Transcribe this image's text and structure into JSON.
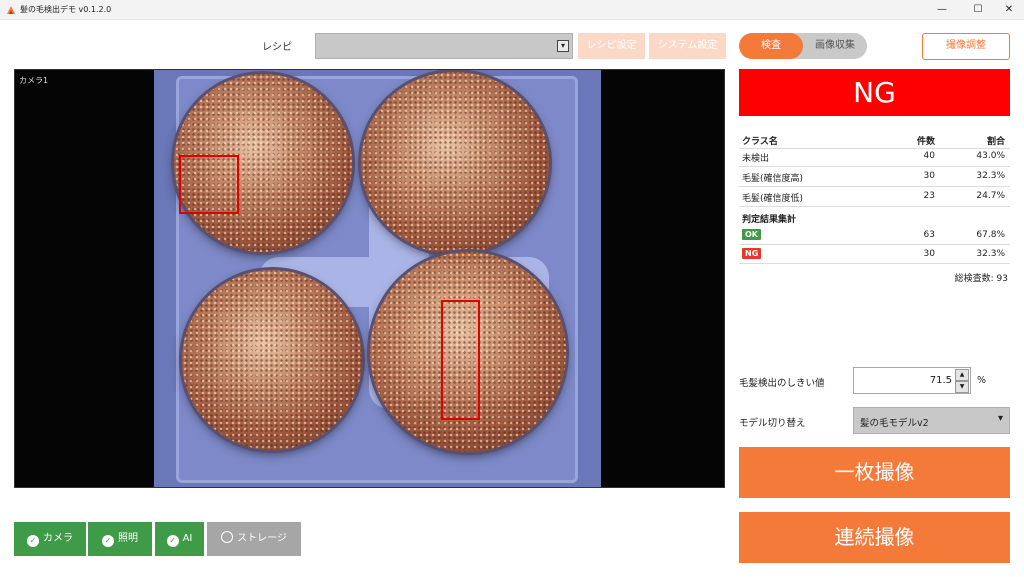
{
  "window": {
    "title": "髪の毛検出デモ v0.1.2.0",
    "minimize_glyph": "—",
    "maximize_glyph": "☐",
    "close_glyph": "✕"
  },
  "toolbar": {
    "recipe_label": "レシピ",
    "recipe_value": "",
    "recipe_settings_label": "レシピ設定",
    "system_settings_label": "システム設定"
  },
  "mode_toggle": {
    "options": [
      "検査",
      "画像収集"
    ],
    "active": "検査"
  },
  "capture_adjust_label": "撮像調整",
  "camera": {
    "label": "カメラ1"
  },
  "result": {
    "verdict": "NG",
    "verdict_color": "#ff0000"
  },
  "stats": {
    "headers": [
      "クラス名",
      "件数",
      "割合"
    ],
    "rows": [
      {
        "name": "未検出",
        "count": "40",
        "ratio": "43.0%"
      },
      {
        "name": "毛髪(確信度高)",
        "count": "30",
        "ratio": "32.3%"
      },
      {
        "name": "毛髪(確信度低)",
        "count": "23",
        "ratio": "24.7%"
      }
    ],
    "summary_title": "判定結果集計",
    "summary": [
      {
        "tag": "OK",
        "tag_color": "#3f9b47",
        "count": "63",
        "ratio": "67.8%"
      },
      {
        "tag": "NG",
        "tag_color": "#e53a2b",
        "count": "30",
        "ratio": "32.3%"
      }
    ],
    "total": "総検査数: 93"
  },
  "threshold": {
    "label": "毛髪検出のしきい値",
    "value": "71.5",
    "unit": "%"
  },
  "model": {
    "label": "モデル切り替え",
    "value": "髪の毛モデルv2"
  },
  "actions": {
    "single_capture": "一枚撮像",
    "continuous_capture": "連続撮像"
  },
  "status": [
    {
      "label": "カメラ",
      "state": "ok",
      "color": "#3f9b47",
      "icon": "check-circle-icon"
    },
    {
      "label": "照明",
      "state": "ok",
      "color": "#3f9b47",
      "icon": "check-circle-icon"
    },
    {
      "label": "AI",
      "state": "ok",
      "color": "#3f9b47",
      "icon": "check-circle-icon"
    },
    {
      "label": "ストレージ",
      "state": "off",
      "color": "#a6a6a6",
      "icon": "empty-circle-icon"
    }
  ],
  "colors": {
    "accent": "#f47a3a",
    "accent_light": "#fbd9c6",
    "ok_green": "#3f9b47"
  }
}
